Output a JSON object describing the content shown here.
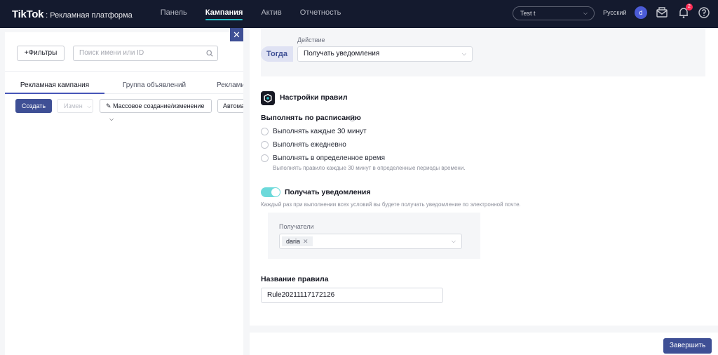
{
  "header": {
    "logo_main": "TikTok",
    "logo_sub": ": Рекламная платформа",
    "nav": [
      {
        "label": "Панель"
      },
      {
        "label": "Кампания"
      },
      {
        "label": "Актив"
      },
      {
        "label": "Отчетность"
      }
    ],
    "account": "Test t",
    "language": "Русский",
    "avatar_letter": "d",
    "notifications_count": "2"
  },
  "left": {
    "filter_button": "+Фильтры",
    "search_placeholder": "Поиск имени или ID",
    "tabs": [
      {
        "label": "Рекламная кампания"
      },
      {
        "label": "Группа объявлений"
      },
      {
        "label": "Реклами"
      }
    ],
    "create_button": "Создать",
    "edit_button": "Измен",
    "mass_button": "Массовое создание/изменение",
    "auto_button": "Автома"
  },
  "drawer": {
    "action_label": "Действие",
    "then_tag": "Тогда",
    "action_value": "Получать уведомления",
    "rules_title": "Настройки правил",
    "schedule_title": "Выполнять по расписанию",
    "schedule_options": [
      {
        "label": "Выполнять каждые 30 минут"
      },
      {
        "label": "Выполнять ежедневно"
      },
      {
        "label": "Выполнять в определенное время"
      }
    ],
    "schedule_hint": "Выполнять правило каждые 30 минут в определенные периоды времени.",
    "notify_title": "Получать уведомления",
    "notify_enabled": true,
    "notify_hint": "Каждый раз при выполнении всех условий вы будете получать уведомление по электронной почте.",
    "recipients_label": "Получатели",
    "recipient_tag": "daria",
    "rule_name_title": "Название правила",
    "rule_name_value": "Rule20211117172126",
    "finish_button": "Завершить"
  },
  "colors": {
    "topbar": "#141a2e",
    "primary": "#3e4f95",
    "accent": "#25c1c7",
    "toggle_on": "#6cd9da",
    "badge": "#fe2c55"
  }
}
